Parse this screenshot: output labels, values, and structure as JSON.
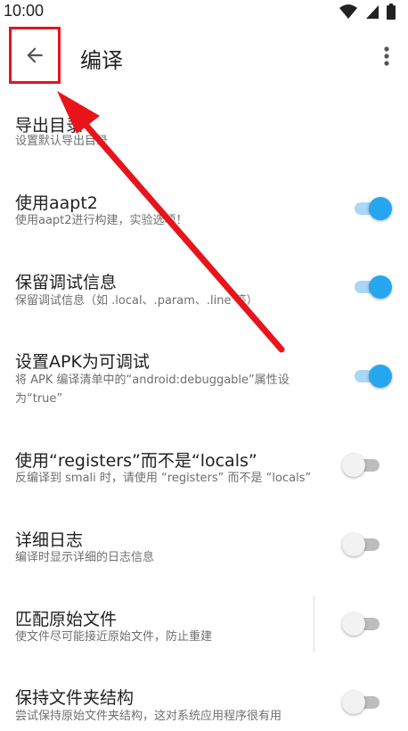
{
  "status_bar": {
    "time": "10:00"
  },
  "app_bar": {
    "title": "编译"
  },
  "settings": [
    {
      "title": "导出目录",
      "summary": "设置默认导出目录",
      "switch": null
    },
    {
      "title": "使用aapt2",
      "summary": "使用aapt2进行构建，实验选项！",
      "switch": true
    },
    {
      "title": "保留调试信息",
      "summary": "保留调试信息（如 .local、.param、.line 等）",
      "switch": true
    },
    {
      "title": "设置APK为可调试",
      "summary": "将 APK 编译清单中的“android:debuggable”属性设",
      "summary2": "为“true”",
      "switch": true
    },
    {
      "title": "使用“registers”而不是“locals”",
      "summary": "反编译到 smali 时，请使用 “registers” 而不是 “locals”",
      "switch": false
    },
    {
      "title": "详细日志",
      "summary": "编译时显示详细的日志信息",
      "switch": false
    },
    {
      "title": "匹配原始文件",
      "summary": "使文件尽可能接近原始文件，防止重建",
      "switch": false
    },
    {
      "title": "保持文件夹结构",
      "summary": "尝试保持原始文件夹结构，这对系统应用程序很有用",
      "switch": false
    }
  ],
  "colors": {
    "accent": "#27a6f0",
    "highlight": "#e8141b"
  },
  "icons": {
    "back": "arrow-left-icon",
    "overflow": "more-vert-icon",
    "wifi": "wifi-icon",
    "signal": "signal-icon",
    "battery": "battery-icon"
  }
}
